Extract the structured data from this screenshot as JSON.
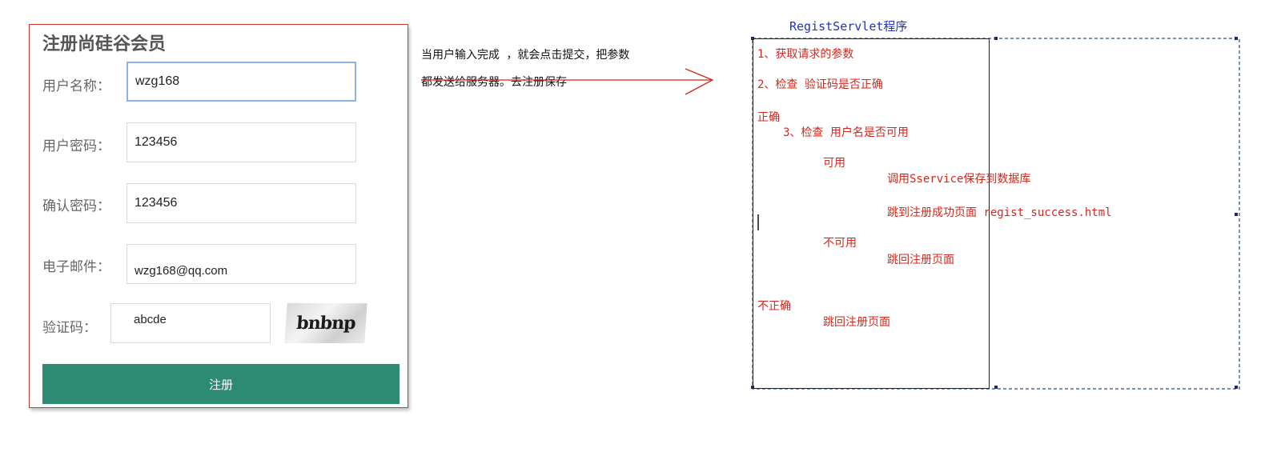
{
  "form": {
    "title": "注册尚硅谷会员",
    "fields": [
      {
        "label": "用户名称：",
        "value": "wzg168"
      },
      {
        "label": "用户密码：",
        "value": "123456"
      },
      {
        "label": "确认密码：",
        "value": "123456"
      },
      {
        "label": "电子邮件：",
        "value": "wzg168@qq.com"
      }
    ],
    "captcha": {
      "label": "验证码：",
      "value": "abcde",
      "image_text": "bnbnp"
    },
    "submit_label": "注册"
  },
  "arrow_note": {
    "line1": "当用户输入完成 ，就会点击提交，把参数",
    "line2": "都发送给服务器。去注册保存"
  },
  "servlet": {
    "title": "RegistServlet程序",
    "steps": [
      "1、获取请求的参数",
      "2、检查 验证码是否正确",
      "正确",
      "3、检查 用户名是否可用",
      "可用",
      "调用Sservice保存到数据库",
      "跳到注册成功页面 regist_success.html",
      "不可用",
      "跳回注册页面",
      "不正确",
      "跳回注册页面"
    ]
  },
  "colors": {
    "panel_border": "#cf3a2e",
    "button": "#2e8b73",
    "step_text": "#d2281e",
    "servlet_title": "#2233bb"
  }
}
